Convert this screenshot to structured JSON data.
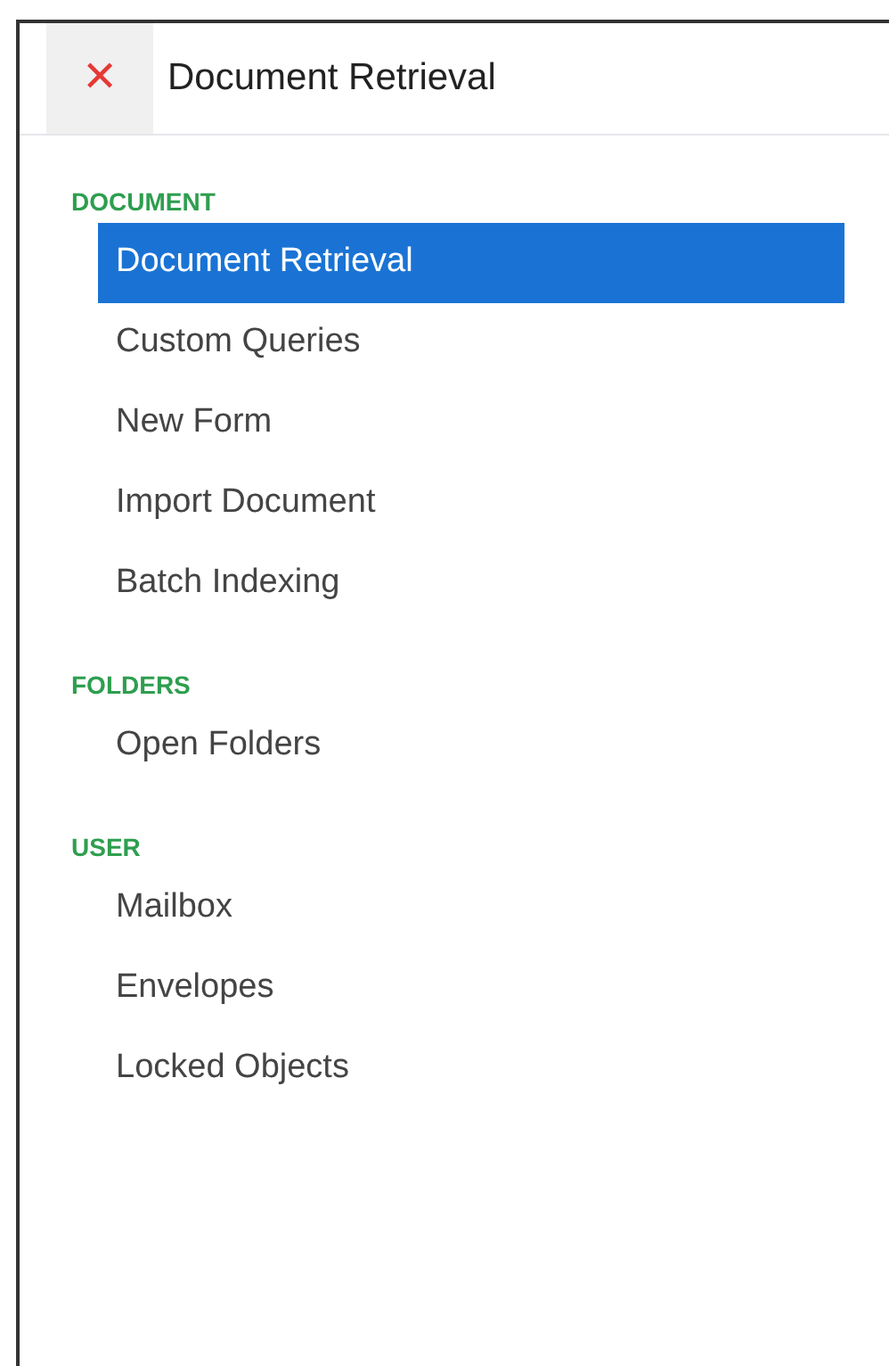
{
  "header": {
    "close": "✕",
    "title": "Document Retrieval"
  },
  "sections": [
    {
      "heading": "DOCUMENT",
      "items": [
        {
          "label": "Document Retrieval",
          "selected": true
        },
        {
          "label": "Custom Queries",
          "selected": false
        },
        {
          "label": "New Form",
          "selected": false
        },
        {
          "label": "Import Document",
          "selected": false
        },
        {
          "label": "Batch Indexing",
          "selected": false
        }
      ]
    },
    {
      "heading": "FOLDERS",
      "items": [
        {
          "label": "Open Folders",
          "selected": false
        }
      ]
    },
    {
      "heading": "USER",
      "items": [
        {
          "label": "Mailbox",
          "selected": false
        },
        {
          "label": "Envelopes",
          "selected": false
        },
        {
          "label": "Locked Objects",
          "selected": false
        }
      ]
    }
  ]
}
